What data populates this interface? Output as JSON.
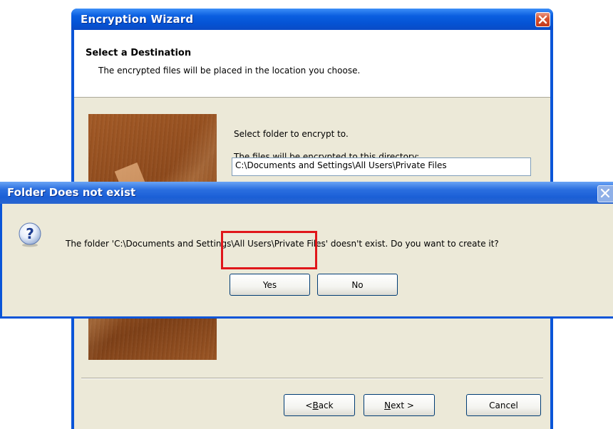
{
  "wizard": {
    "title": "Encryption Wizard",
    "header_title": "Select a Destination",
    "header_subtitle": "The encrypted files will be placed in the location you choose.",
    "select_label": "Select folder to encrypt to.",
    "directory_label": "The files will be encrypted to this directory:",
    "directory_value": "C:\\Documents and Settings\\All Users\\Private Files",
    "buttons": {
      "back_prefix": "< ",
      "back_key": "B",
      "back_rest": "ack",
      "next_key": "N",
      "next_rest": "ext >",
      "cancel": "Cancel"
    }
  },
  "dialog": {
    "title": "Folder Does not exist",
    "message": "The folder 'C:\\Documents and Settings\\All Users\\Private Files' doesn't exist.  Do you want to create it?",
    "icon": "question-icon",
    "yes_label": "Yes",
    "no_label": "No"
  },
  "colors": {
    "titlebar": "#0a5ee0",
    "dialog_face": "#ece9d8",
    "highlight": "#e0161a"
  }
}
